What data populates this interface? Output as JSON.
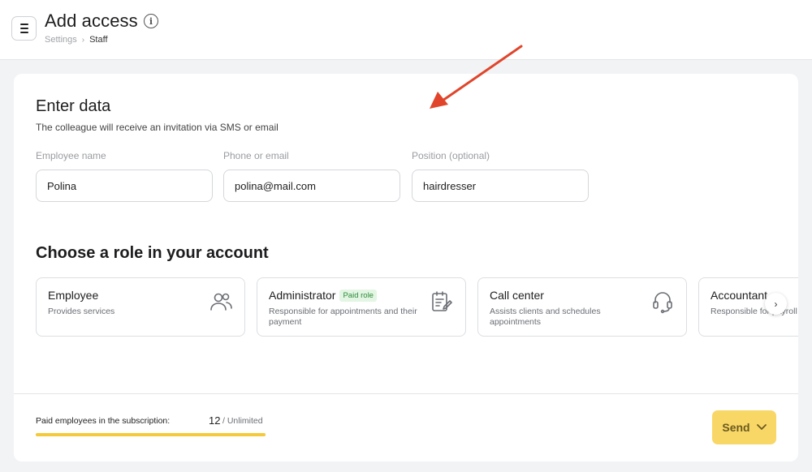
{
  "header": {
    "title": "Add access",
    "info_icon": "info-icon",
    "breadcrumb": [
      "Settings",
      "Staff"
    ]
  },
  "form": {
    "title": "Enter data",
    "subtitle": "The colleague will receive an invitation via SMS or email",
    "fields": [
      {
        "label": "Employee name",
        "value": "Polina"
      },
      {
        "label": "Phone or email",
        "value": "polina@mail.com"
      },
      {
        "label": "Position (optional)",
        "value": "hairdresser"
      }
    ]
  },
  "roles": {
    "title": "Choose a role in your account",
    "items": [
      {
        "name": "Employee",
        "desc": "Provides services",
        "icon": "users-icon"
      },
      {
        "name": "Administrator",
        "badge": "Paid role",
        "desc": "Responsible for appointments and their payment",
        "icon": "clipboard-edit-icon"
      },
      {
        "name": "Call center",
        "desc": "Assists clients and schedules appointments",
        "icon": "headset-icon"
      },
      {
        "name": "Accountant",
        "desc": "Responsible for payroll",
        "icon": "calculator-icon"
      }
    ]
  },
  "footer": {
    "limit_label": "Paid employees in the subscription:",
    "limit_count": "12",
    "limit_total": "/ Unlimited",
    "progress": 1.0,
    "send_label": "Send"
  },
  "colors": {
    "accent": "#f8d766",
    "progress": "#f4c93a",
    "annotation_arrow": "#e0452c",
    "badge_bg": "#e3f5e3",
    "badge_text": "#2e8b3a"
  }
}
